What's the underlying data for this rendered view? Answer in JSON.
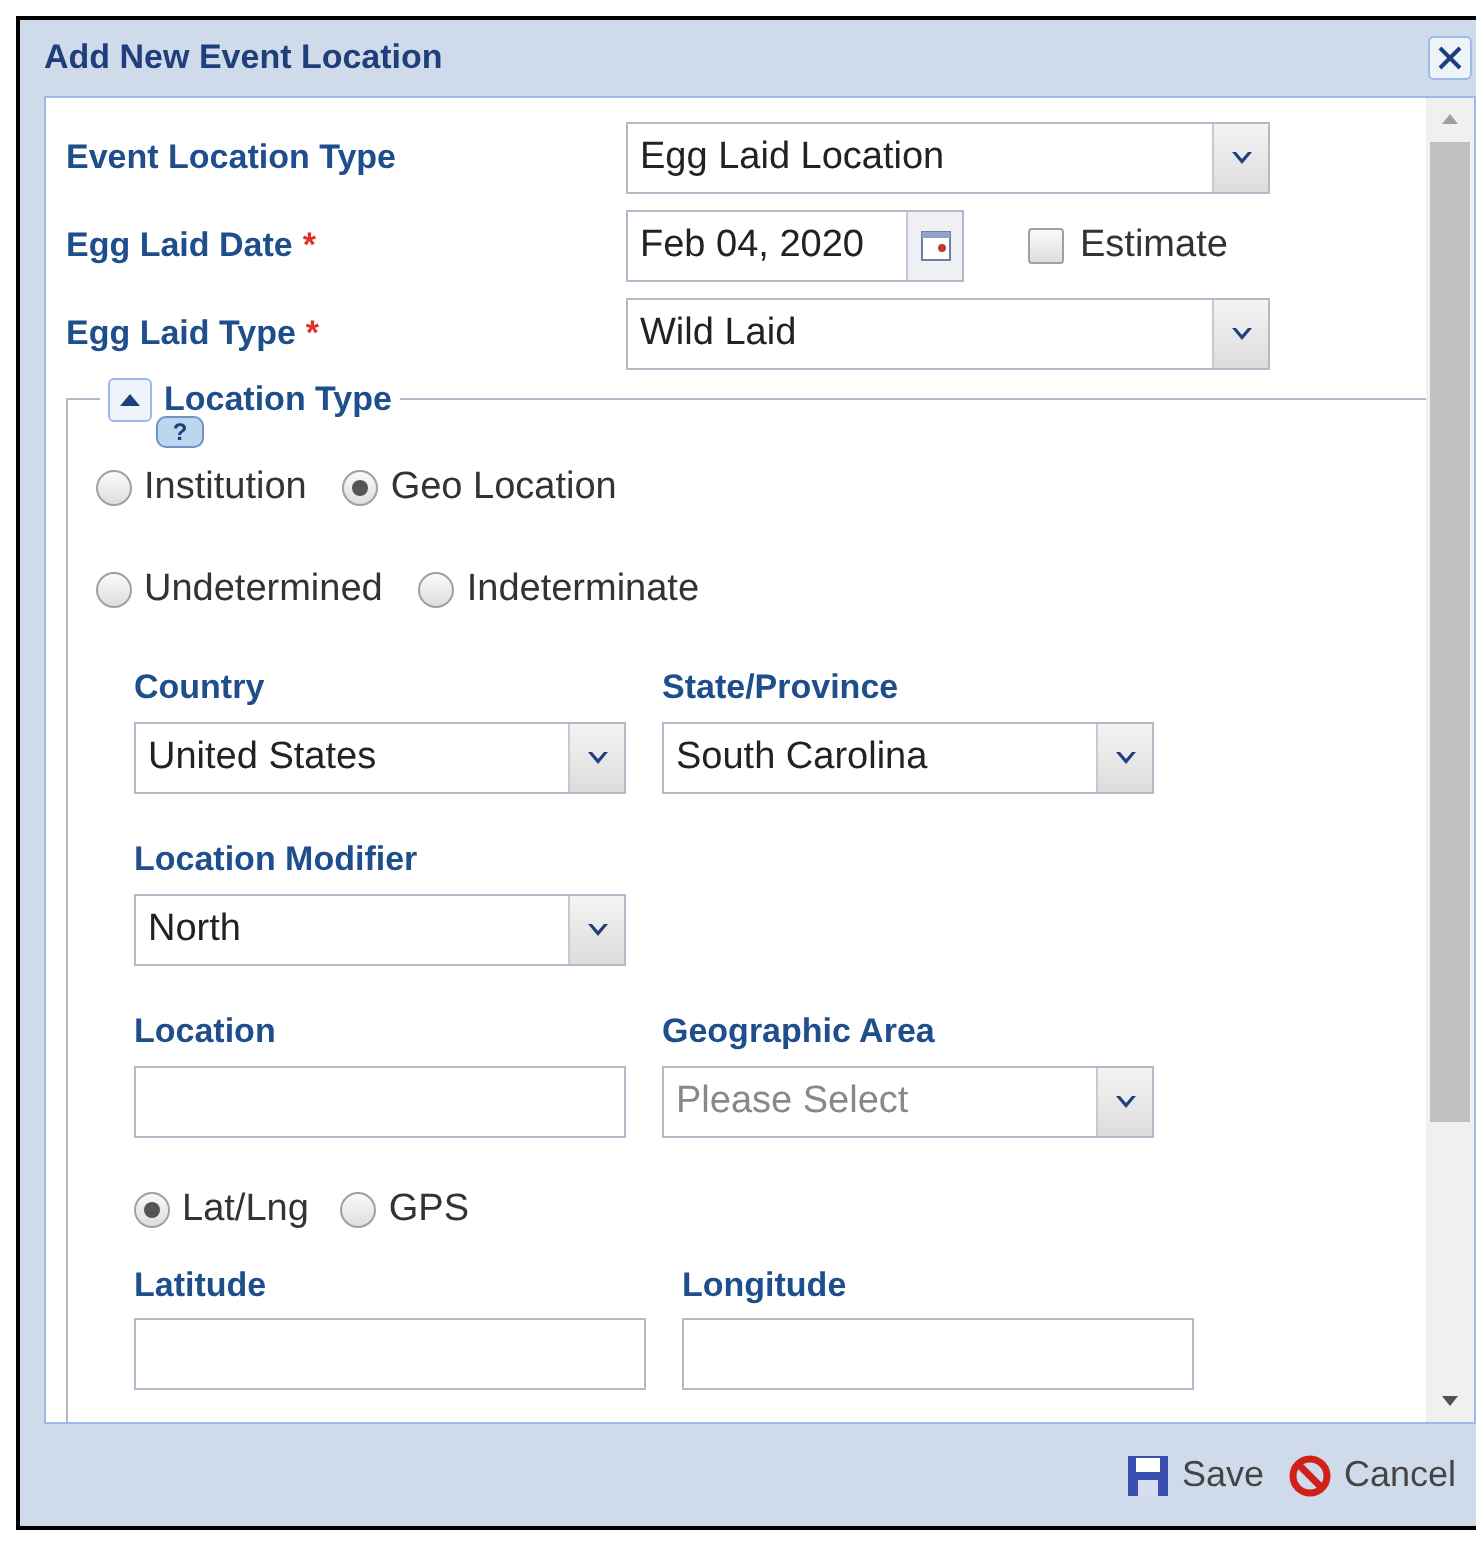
{
  "window": {
    "title": "Add New Event Location"
  },
  "fields": [
    {
      "kind": "select",
      "label": "Event Location Type",
      "value": "Egg Laid Location"
    },
    {
      "kind": "date",
      "label": "Egg Laid Date",
      "required": "*",
      "value": "Feb 04, 2020",
      "checkbox": {
        "label": "Estimate",
        "checked": false
      }
    },
    {
      "kind": "select",
      "label": "Egg Laid Type",
      "required": "*",
      "value": "Wild Laid"
    }
  ],
  "location_type": {
    "legend": "Location Type",
    "expanded": true,
    "radios": [
      [
        {
          "label": "Institution",
          "selected": false,
          "help": "?"
        },
        {
          "label": "Geo Location",
          "selected": true
        }
      ],
      [
        {
          "label": "Undetermined",
          "selected": false
        },
        {
          "label": "Indeterminate",
          "selected": false
        }
      ]
    ],
    "rows": [
      [
        {
          "kind": "select",
          "label": "Country",
          "value": "United States"
        },
        {
          "kind": "select",
          "label": "State/Province",
          "value": "South Carolina"
        }
      ],
      [
        {
          "kind": "select",
          "label": "Location Modifier",
          "value": "North"
        }
      ],
      [
        {
          "kind": "text",
          "label": "Location"
        },
        {
          "kind": "select",
          "label": "Geographic Area",
          "placeholder": "Please Select"
        }
      ]
    ],
    "coordinate_modes": [
      {
        "label": "Lat/Lng",
        "selected": true
      },
      {
        "label": "GPS",
        "selected": false
      }
    ],
    "coordinates": [
      {
        "kind": "text",
        "label": "Latitude"
      },
      {
        "kind": "text",
        "label": "Longitude"
      }
    ]
  },
  "buttons": [
    {
      "kind": "save",
      "label": "Save"
    },
    {
      "kind": "cancel",
      "label": "Cancel"
    }
  ]
}
